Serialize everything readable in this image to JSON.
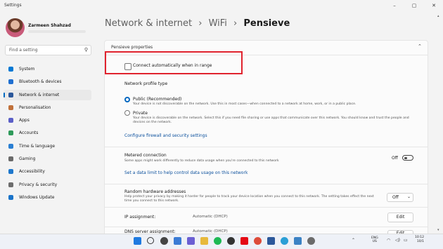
{
  "window": {
    "app_title": "Settings",
    "minimize": "–",
    "maximize": "▢",
    "close": "✕"
  },
  "user": {
    "name": "Zarmeen Shahzad"
  },
  "search": {
    "placeholder": "Find a setting",
    "icon": "search-icon"
  },
  "sidebar": {
    "items": [
      {
        "label": "System",
        "icon": "monitor-icon",
        "color": "#0078d4"
      },
      {
        "label": "Bluetooth & devices",
        "icon": "bluetooth-icon",
        "color": "#1f6fd1"
      },
      {
        "label": "Network & internet",
        "icon": "wifi-icon",
        "color": "#2b579a",
        "active": true
      },
      {
        "label": "Personalisation",
        "icon": "brush-icon",
        "color": "#c0703a"
      },
      {
        "label": "Apps",
        "icon": "apps-icon",
        "color": "#5b5fc7"
      },
      {
        "label": "Accounts",
        "icon": "person-icon",
        "color": "#2e9a5a"
      },
      {
        "label": "Time & language",
        "icon": "globe-clock-icon",
        "color": "#2a7fd3"
      },
      {
        "label": "Gaming",
        "icon": "gamepad-icon",
        "color": "#6a6a6a"
      },
      {
        "label": "Accessibility",
        "icon": "accessibility-icon",
        "color": "#1e77cc"
      },
      {
        "label": "Privacy & security",
        "icon": "shield-icon",
        "color": "#6d6d6d"
      },
      {
        "label": "Windows Update",
        "icon": "update-icon",
        "color": "#1a73c9"
      }
    ]
  },
  "breadcrumb": {
    "part1": "Network & internet",
    "sep1": "›",
    "part2": "WiFi",
    "sep2": "›",
    "current": "Pensieve"
  },
  "properties": {
    "section_title": "Pensieve properties",
    "connect_auto": {
      "label": "Connect automatically when in range",
      "checked": false
    },
    "profile_heading": "Network profile type",
    "public_title": "Public (Recommended)",
    "public_desc": "Your device is not discoverable on the network. Use this in most cases—when connected to a network at home, work, or in a public place.",
    "private_title": "Private",
    "private_desc": "Your device is discoverable on the network. Select this if you need file sharing or use apps that communicate over this network. You should know and trust the people and devices on the network.",
    "firewall_link": "Configure firewall and security settings",
    "metered_title": "Metered connection",
    "metered_desc": "Some apps might work differently to reduce data usage when you're connected to this network",
    "metered_state": "Off",
    "data_limit_link": "Set a data limit to help control data usage on this network",
    "random_title": "Random hardware addresses",
    "random_desc": "Help protect your privacy by making it harder for people to track your device location when you connect to this network. The setting takes effect the next time you connect to this network.",
    "random_value": "Off",
    "ip_label": "IP assignment:",
    "ip_value": "Automatic (DHCP)",
    "ip_edit": "Edit",
    "dns_label": "DNS server assignment:",
    "dns_value": "Automatic (DHCP)",
    "dns_edit": "Edit"
  },
  "taskbar": {
    "icons": [
      {
        "name": "windows-start-icon",
        "color": "#1f7ae0"
      },
      {
        "name": "search-icon",
        "color": "#333333"
      },
      {
        "name": "task-view-icon",
        "color": "#444444"
      },
      {
        "name": "widgets-icon",
        "color": "#3a7bd5"
      },
      {
        "name": "chat-icon",
        "color": "#6b5fd3"
      },
      {
        "name": "file-explorer-icon",
        "color": "#e7b93c"
      },
      {
        "name": "spotify-icon",
        "color": "#1db954"
      },
      {
        "name": "xbox-icon",
        "color": "#333333"
      },
      {
        "name": "netflix-icon",
        "color": "#e50914"
      },
      {
        "name": "chrome-icon",
        "color": "#dd4b39"
      },
      {
        "name": "word-icon",
        "color": "#2b579a"
      },
      {
        "name": "edge-icon",
        "color": "#2a9fd6"
      },
      {
        "name": "photos-icon",
        "color": "#3b82c4"
      },
      {
        "name": "settings-icon",
        "color": "#6b6b6b"
      }
    ],
    "lang_top": "ENG",
    "lang_bottom": "US",
    "time": "10:12",
    "date": "10/1"
  }
}
